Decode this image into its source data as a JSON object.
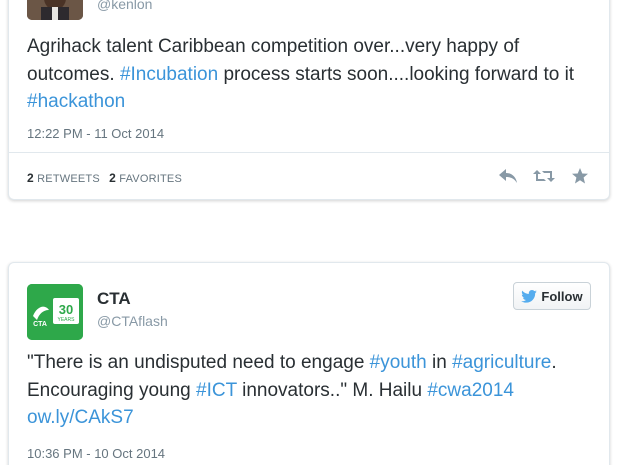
{
  "tweet1": {
    "handle": "@kenlon",
    "text_parts": [
      {
        "type": "text",
        "value": "Agrihack talent Caribbean competition over...very happy of outcomes. "
      },
      {
        "type": "hashtag",
        "value": "#Incubation"
      },
      {
        "type": "text",
        "value": " process starts soon....looking forward to it "
      },
      {
        "type": "hashtag",
        "value": "#hackathon"
      }
    ],
    "timestamp": "12:22 PM - 11 Oct 2014",
    "retweets_count": "2",
    "retweets_label": "RETWEETS",
    "favorites_count": "2",
    "favorites_label": "FAVORITES",
    "actions": [
      "reply-icon",
      "retweet-icon",
      "favorite-icon"
    ]
  },
  "tweet2": {
    "name": "CTA",
    "handle": "@CTAflash",
    "follow_label": "Follow",
    "avatar": {
      "badge_text": "30",
      "badge_sub": "YEARS",
      "logo_text": "CTA"
    },
    "text_parts": [
      {
        "type": "text",
        "value": "\"There is an undisputed need to engage "
      },
      {
        "type": "hashtag",
        "value": "#youth"
      },
      {
        "type": "text",
        "value": " in "
      },
      {
        "type": "hashtag",
        "value": "#agriculture"
      },
      {
        "type": "text",
        "value": ". Encouraging young "
      },
      {
        "type": "hashtag",
        "value": "#ICT"
      },
      {
        "type": "text",
        "value": " innovators..\" M. Hailu "
      },
      {
        "type": "hashtag",
        "value": "#cwa2014"
      },
      {
        "type": "text",
        "value": " "
      },
      {
        "type": "link",
        "value": "ow.ly/CAkS7"
      }
    ],
    "timestamp": "10:36 PM - 10 Oct 2014"
  },
  "colors": {
    "link": "#3b94d9",
    "text": "#292f33",
    "muted": "#8899a6",
    "twitter_blue": "#55acee",
    "cta_green": "#2ea84a"
  }
}
